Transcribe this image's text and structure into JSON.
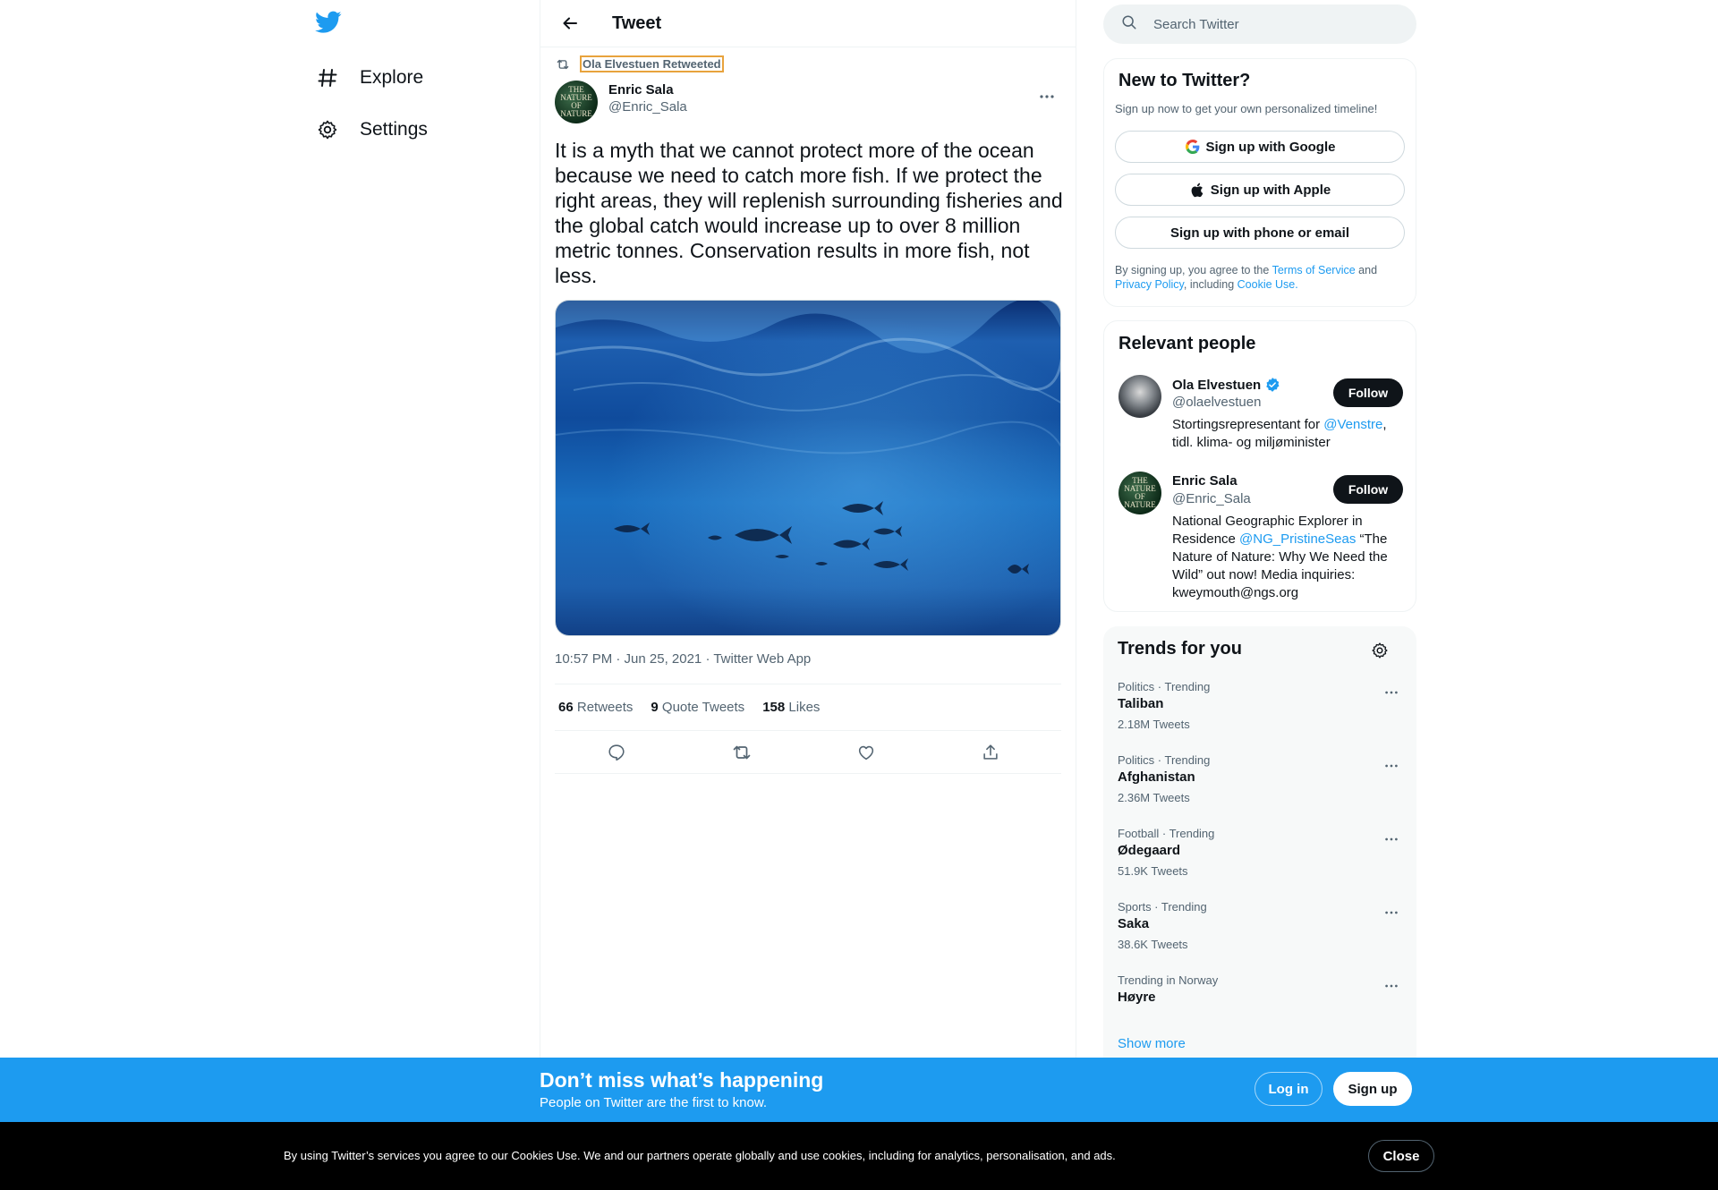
{
  "nav": {
    "explore_label": "Explore",
    "settings_label": "Settings"
  },
  "header": {
    "title": "Tweet"
  },
  "tweet": {
    "retweeted_by": "Ola Elvestuen Retweeted",
    "author_name": "Enric Sala",
    "author_handle": "@Enric_Sala",
    "avatar_text": "THE NATURE OF NATURE",
    "text": "It is a myth that we cannot protect more of the ocean because we need to catch more fish. If we protect the right areas, they will replenish surrounding fisheries and the global catch would increase up to over 8 million metric tonnes. Conservation results in more fish, not less.",
    "meta": "10:57 PM · Jun 25, 2021 · Twitter Web App",
    "stats": {
      "retweets_count": "66",
      "retweets_label": "Retweets",
      "quotes_count": "9",
      "quotes_label": "Quote Tweets",
      "likes_count": "158",
      "likes_label": "Likes"
    },
    "actions": [
      "reply-icon",
      "retweet-icon",
      "like-icon",
      "share-icon"
    ]
  },
  "search": {
    "placeholder": "Search Twitter"
  },
  "new_to_twitter": {
    "title": "New to Twitter?",
    "subtitle": "Sign up now to get your own personalized timeline!",
    "google_label": "Sign up with Google",
    "apple_label": "Sign up with Apple",
    "email_label": "Sign up with phone or email",
    "legal_prefix": "By signing up, you agree to the ",
    "terms_link": "Terms of Service",
    "legal_and": " and ",
    "privacy_link": "Privacy Policy",
    "legal_including": ", including ",
    "cookie_link": "Cookie Use."
  },
  "relevant_people": {
    "title": "Relevant people",
    "people": [
      {
        "name": "Ola Elvestuen",
        "handle": "@olaelvestuen",
        "verified": true,
        "bio_prefix": "Stortingsrepresentant for ",
        "bio_link": "@Venstre",
        "bio_suffix": ", tidl. klima- og miljøminister",
        "follow_label": "Follow"
      },
      {
        "name": "Enric Sala",
        "handle": "@Enric_Sala",
        "verified": false,
        "bio_prefix": "National Geographic Explorer in Residence ",
        "bio_link": "@NG_PristineSeas",
        "bio_suffix": " “The Nature of Nature: Why We Need the Wild” out now! Media inquiries: kweymouth@ngs.org",
        "follow_label": "Follow"
      }
    ]
  },
  "trends": {
    "title": "Trends for you",
    "items": [
      {
        "category": "Politics · Trending",
        "name": "Taliban",
        "count": "2.18M Tweets"
      },
      {
        "category": "Politics · Trending",
        "name": "Afghanistan",
        "count": "2.36M Tweets"
      },
      {
        "category": "Football · Trending",
        "name": "Ødegaard",
        "count": "51.9K Tweets"
      },
      {
        "category": "Sports · Trending",
        "name": "Saka",
        "count": "38.6K Tweets"
      },
      {
        "category": "Trending in Norway",
        "name": "Høyre",
        "count": ""
      }
    ],
    "show_more": "Show more"
  },
  "banner": {
    "title": "Don’t miss what’s happening",
    "subtitle": "People on Twitter are the first to know.",
    "login_label": "Log in",
    "signup_label": "Sign up"
  },
  "cookie": {
    "text": "By using Twitter’s services you agree to our Cookies Use. We and our partners operate globally and use cookies, including for analytics, personalisation, and ads.",
    "close_label": "Close"
  },
  "colors": {
    "brand": "#1d9bf0",
    "text": "#0f1419",
    "muted": "#536471",
    "border": "#eff3f4",
    "ocean_light": "#2b83c8",
    "ocean_dark": "#0a2f6e"
  }
}
